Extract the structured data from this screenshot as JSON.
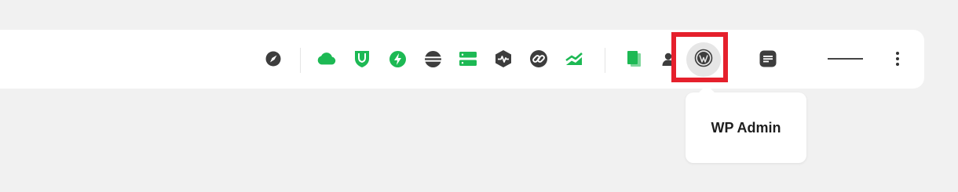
{
  "toolbar": {
    "icons": [
      "compass-icon",
      "cloud-icon",
      "shield-icon",
      "lightning-icon",
      "database-icon",
      "server-icon",
      "heartbeat-icon",
      "link-icon",
      "trending-chart-icon",
      "pages-icon",
      "user-icon",
      "wordpress-icon",
      "notes-icon",
      "more-vertical-icon"
    ],
    "accent_color": "#1db954",
    "dark_color": "#3d3d3d",
    "highlight_color": "#e5202c"
  },
  "tooltip": {
    "label": "WP Admin"
  }
}
